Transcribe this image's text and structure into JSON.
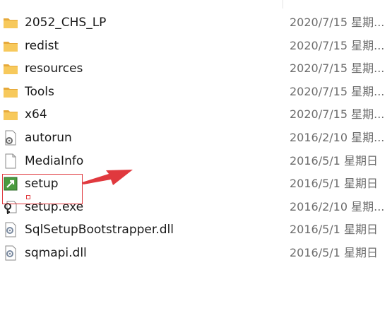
{
  "files": [
    {
      "name": "2052_CHS_LP",
      "date": "2020/7/15 星期...",
      "icon": "folder-icon"
    },
    {
      "name": "redist",
      "date": "2020/7/15 星期...",
      "icon": "folder-icon"
    },
    {
      "name": "resources",
      "date": "2020/7/15 星期...",
      "icon": "folder-icon"
    },
    {
      "name": "Tools",
      "date": "2020/7/15 星期...",
      "icon": "folder-icon"
    },
    {
      "name": "x64",
      "date": "2020/7/15 星期...",
      "icon": "folder-icon"
    },
    {
      "name": "autorun",
      "date": "2016/2/10 星期...",
      "icon": "settings-file-icon"
    },
    {
      "name": "MediaInfo",
      "date": "2016/5/1 星期日",
      "icon": "document-icon"
    },
    {
      "name": "setup",
      "date": "2016/5/1 星期日",
      "icon": "setup-app-icon"
    },
    {
      "name": "setup.exe",
      "date": "2016/2/10 星期...",
      "icon": "exe-shortcut-icon"
    },
    {
      "name": "SqlSetupBootstrapper.dll",
      "date": "2016/5/1 星期日",
      "icon": "dll-icon"
    },
    {
      "name": "sqmapi.dll",
      "date": "2016/5/1 星期日",
      "icon": "dll-icon"
    }
  ],
  "colors": {
    "folder": "#f7c95c",
    "folder_dark": "#e6a93a",
    "annotation": "#e0393e",
    "date_text": "#6d6d6d"
  }
}
